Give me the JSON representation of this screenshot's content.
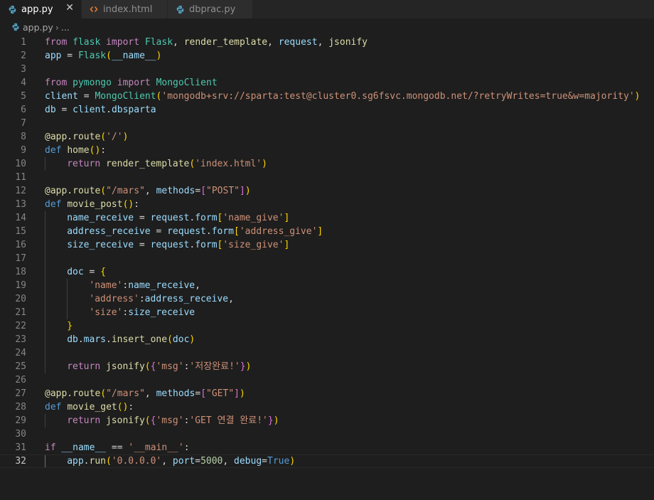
{
  "tabs": [
    {
      "label": "app.py",
      "icon": "python-icon",
      "active": true,
      "close": "✕"
    },
    {
      "label": "index.html",
      "icon": "html-icon",
      "active": false
    },
    {
      "label": "dbprac.py",
      "icon": "python-icon",
      "active": false
    }
  ],
  "breadcrumb": {
    "file": "app.py",
    "separator": "›",
    "more": "..."
  },
  "colors": {
    "background": "#1e1e1e",
    "keyword": "#c586c0",
    "builtin": "#569cd6",
    "variable": "#9cdcfe",
    "function": "#dcdcaa",
    "class": "#4ec9b0",
    "string": "#ce9178",
    "number": "#b5cea8"
  },
  "current_line": 32,
  "code_lines": [
    {
      "n": "1",
      "tokens": [
        [
          "kw",
          "from"
        ],
        [
          "op",
          " "
        ],
        [
          "cl",
          "flask"
        ],
        [
          "op",
          " "
        ],
        [
          "kw",
          "import"
        ],
        [
          "op",
          " "
        ],
        [
          "cl",
          "Flask"
        ],
        [
          "op",
          ", "
        ],
        [
          "fn",
          "render_template"
        ],
        [
          "op",
          ", "
        ],
        [
          "id",
          "request"
        ],
        [
          "op",
          ", "
        ],
        [
          "fn",
          "jsonify"
        ]
      ]
    },
    {
      "n": "2",
      "tokens": [
        [
          "id",
          "app"
        ],
        [
          "op",
          " = "
        ],
        [
          "cl",
          "Flask"
        ],
        [
          "b1",
          "("
        ],
        [
          "id",
          "__name__"
        ],
        [
          "b1",
          ")"
        ]
      ]
    },
    {
      "n": "3",
      "tokens": []
    },
    {
      "n": "4",
      "tokens": [
        [
          "kw",
          "from"
        ],
        [
          "op",
          " "
        ],
        [
          "cl",
          "pymongo"
        ],
        [
          "op",
          " "
        ],
        [
          "kw",
          "import"
        ],
        [
          "op",
          " "
        ],
        [
          "cl",
          "MongoClient"
        ]
      ]
    },
    {
      "n": "5",
      "tokens": [
        [
          "id",
          "client"
        ],
        [
          "op",
          " = "
        ],
        [
          "cl",
          "MongoClient"
        ],
        [
          "b1",
          "("
        ],
        [
          "st",
          "'mongodb+srv://sparta:test@cluster0.sg6fsvc.mongodb.net/?retryWrites=true&w=majority'"
        ],
        [
          "b1",
          ")"
        ]
      ]
    },
    {
      "n": "6",
      "tokens": [
        [
          "id",
          "db"
        ],
        [
          "op",
          " = "
        ],
        [
          "id",
          "client"
        ],
        [
          "op",
          "."
        ],
        [
          "id",
          "dbsparta"
        ]
      ]
    },
    {
      "n": "7",
      "tokens": []
    },
    {
      "n": "8",
      "tokens": [
        [
          "fn",
          "@app.route"
        ],
        [
          "b1",
          "("
        ],
        [
          "st",
          "'/'"
        ],
        [
          "b1",
          ")"
        ]
      ]
    },
    {
      "n": "9",
      "tokens": [
        [
          "bl",
          "def"
        ],
        [
          "op",
          " "
        ],
        [
          "fn",
          "home"
        ],
        [
          "b1",
          "()"
        ],
        [
          "op",
          ":"
        ]
      ]
    },
    {
      "n": "10",
      "indent": 1,
      "tokens": [
        [
          "kw",
          "return"
        ],
        [
          "op",
          " "
        ],
        [
          "fn",
          "render_template"
        ],
        [
          "b1",
          "("
        ],
        [
          "st",
          "'index.html'"
        ],
        [
          "b1",
          ")"
        ]
      ]
    },
    {
      "n": "11",
      "tokens": []
    },
    {
      "n": "12",
      "tokens": [
        [
          "fn",
          "@app.route"
        ],
        [
          "b1",
          "("
        ],
        [
          "st",
          "\"/mars\""
        ],
        [
          "op",
          ", "
        ],
        [
          "id",
          "methods"
        ],
        [
          "op",
          "="
        ],
        [
          "b2",
          "["
        ],
        [
          "st",
          "\"POST\""
        ],
        [
          "b2",
          "]"
        ],
        [
          "b1",
          ")"
        ]
      ]
    },
    {
      "n": "13",
      "tokens": [
        [
          "bl",
          "def"
        ],
        [
          "op",
          " "
        ],
        [
          "fn",
          "movie_post"
        ],
        [
          "b1",
          "()"
        ],
        [
          "op",
          ":"
        ]
      ]
    },
    {
      "n": "14",
      "indent": 1,
      "tokens": [
        [
          "id",
          "name_receive"
        ],
        [
          "op",
          " = "
        ],
        [
          "id",
          "request"
        ],
        [
          "op",
          "."
        ],
        [
          "id",
          "form"
        ],
        [
          "b1",
          "["
        ],
        [
          "st",
          "'name_give'"
        ],
        [
          "b1",
          "]"
        ]
      ]
    },
    {
      "n": "15",
      "indent": 1,
      "tokens": [
        [
          "id",
          "address_receive"
        ],
        [
          "op",
          " = "
        ],
        [
          "id",
          "request"
        ],
        [
          "op",
          "."
        ],
        [
          "id",
          "form"
        ],
        [
          "b1",
          "["
        ],
        [
          "st",
          "'address_give'"
        ],
        [
          "b1",
          "]"
        ]
      ]
    },
    {
      "n": "16",
      "indent": 1,
      "tokens": [
        [
          "id",
          "size_receive"
        ],
        [
          "op",
          " = "
        ],
        [
          "id",
          "request"
        ],
        [
          "op",
          "."
        ],
        [
          "id",
          "form"
        ],
        [
          "b1",
          "["
        ],
        [
          "st",
          "'size_give'"
        ],
        [
          "b1",
          "]"
        ]
      ]
    },
    {
      "n": "17",
      "indent": 1,
      "tokens": []
    },
    {
      "n": "18",
      "indent": 1,
      "tokens": [
        [
          "id",
          "doc"
        ],
        [
          "op",
          " = "
        ],
        [
          "b1",
          "{"
        ]
      ]
    },
    {
      "n": "19",
      "indent": 2,
      "tokens": [
        [
          "st",
          "'name'"
        ],
        [
          "op",
          ":"
        ],
        [
          "id",
          "name_receive"
        ],
        [
          "op",
          ","
        ]
      ]
    },
    {
      "n": "20",
      "indent": 2,
      "tokens": [
        [
          "st",
          "'address'"
        ],
        [
          "op",
          ":"
        ],
        [
          "id",
          "address_receive"
        ],
        [
          "op",
          ","
        ]
      ]
    },
    {
      "n": "21",
      "indent": 2,
      "tokens": [
        [
          "st",
          "'size'"
        ],
        [
          "op",
          ":"
        ],
        [
          "id",
          "size_receive"
        ]
      ]
    },
    {
      "n": "22",
      "indent": 1,
      "tokens": [
        [
          "b1",
          "}"
        ]
      ]
    },
    {
      "n": "23",
      "indent": 1,
      "tokens": [
        [
          "id",
          "db"
        ],
        [
          "op",
          "."
        ],
        [
          "id",
          "mars"
        ],
        [
          "op",
          "."
        ],
        [
          "fn",
          "insert_one"
        ],
        [
          "b1",
          "("
        ],
        [
          "id",
          "doc"
        ],
        [
          "b1",
          ")"
        ]
      ]
    },
    {
      "n": "24",
      "indent": 1,
      "tokens": []
    },
    {
      "n": "25",
      "indent": 1,
      "tokens": [
        [
          "kw",
          "return"
        ],
        [
          "op",
          " "
        ],
        [
          "fn",
          "jsonify"
        ],
        [
          "b1",
          "("
        ],
        [
          "b2",
          "{"
        ],
        [
          "st",
          "'msg'"
        ],
        [
          "op",
          ":"
        ],
        [
          "st",
          "'저장완료!'"
        ],
        [
          "b2",
          "}"
        ],
        [
          "b1",
          ")"
        ]
      ]
    },
    {
      "n": "26",
      "tokens": []
    },
    {
      "n": "27",
      "tokens": [
        [
          "fn",
          "@app.route"
        ],
        [
          "b1",
          "("
        ],
        [
          "st",
          "\"/mars\""
        ],
        [
          "op",
          ", "
        ],
        [
          "id",
          "methods"
        ],
        [
          "op",
          "="
        ],
        [
          "b2",
          "["
        ],
        [
          "st",
          "\"GET\""
        ],
        [
          "b2",
          "]"
        ],
        [
          "b1",
          ")"
        ]
      ]
    },
    {
      "n": "28",
      "tokens": [
        [
          "bl",
          "def"
        ],
        [
          "op",
          " "
        ],
        [
          "fn",
          "movie_get"
        ],
        [
          "b1",
          "()"
        ],
        [
          "op",
          ":"
        ]
      ]
    },
    {
      "n": "29",
      "indent": 1,
      "tokens": [
        [
          "kw",
          "return"
        ],
        [
          "op",
          " "
        ],
        [
          "fn",
          "jsonify"
        ],
        [
          "b1",
          "("
        ],
        [
          "b2",
          "{"
        ],
        [
          "st",
          "'msg'"
        ],
        [
          "op",
          ":"
        ],
        [
          "st",
          "'GET 연결 완료!'"
        ],
        [
          "b2",
          "}"
        ],
        [
          "b1",
          ")"
        ]
      ]
    },
    {
      "n": "30",
      "tokens": []
    },
    {
      "n": "31",
      "tokens": [
        [
          "kw",
          "if"
        ],
        [
          "op",
          " "
        ],
        [
          "id",
          "__name__"
        ],
        [
          "op",
          " == "
        ],
        [
          "st",
          "'__main__'"
        ],
        [
          "op",
          ":"
        ]
      ]
    },
    {
      "n": "32",
      "indent": 1,
      "tokens": [
        [
          "id",
          "app"
        ],
        [
          "op",
          "."
        ],
        [
          "fn",
          "run"
        ],
        [
          "b1",
          "("
        ],
        [
          "st",
          "'0.0.0.0'"
        ],
        [
          "op",
          ", "
        ],
        [
          "id",
          "port"
        ],
        [
          "op",
          "="
        ],
        [
          "nm",
          "5000"
        ],
        [
          "op",
          ", "
        ],
        [
          "id",
          "debug"
        ],
        [
          "op",
          "="
        ],
        [
          "bl",
          "True"
        ],
        [
          "b1",
          ")"
        ]
      ]
    }
  ]
}
